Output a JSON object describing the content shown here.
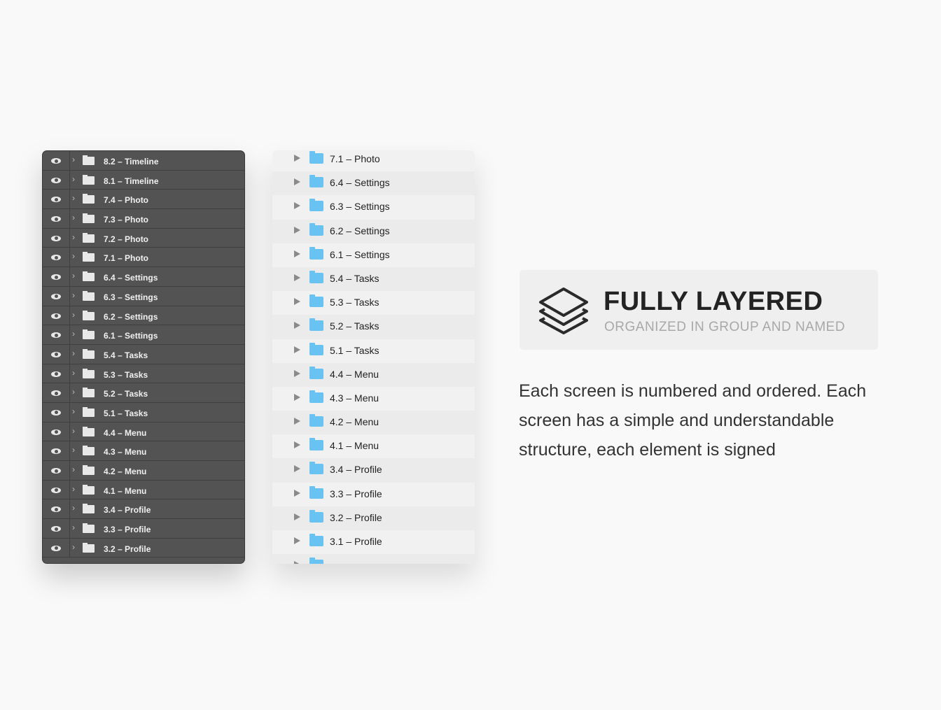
{
  "dark_panel": {
    "layers": [
      "8.2 – Timeline",
      "8.1 – Timeline",
      "7.4 – Photo",
      "7.3 – Photo",
      "7.2 – Photo",
      "7.1 – Photo",
      "6.4 – Settings",
      "6.3 – Settings",
      "6.2 – Settings",
      "6.1 – Settings",
      "5.4 – Tasks",
      "5.3 – Tasks",
      "5.2 – Tasks",
      "5.1 – Tasks",
      "4.4 – Menu",
      "4.3 – Menu",
      "4.2 – Menu",
      "4.1 – Menu",
      "3.4 – Profile",
      "3.3 – Profile",
      "3.2 – Profile"
    ]
  },
  "light_panel": {
    "folders": [
      "7.1 – Photo",
      "6.4 – Settings",
      "6.3 – Settings",
      "6.2 – Settings",
      "6.1 – Settings",
      "5.4 – Tasks",
      "5.3 – Tasks",
      "5.2 – Tasks",
      "5.1 – Tasks",
      "4.4 – Menu",
      "4.3 – Menu",
      "4.2 – Menu",
      "4.1 – Menu",
      "3.4 – Profile",
      "3.3 – Profile",
      "3.2 – Profile",
      "3.1 – Profile"
    ],
    "folder_color": "#68c3f3"
  },
  "feature": {
    "icon": "layers-icon",
    "title": "FULLY LAYERED",
    "subtitle": "ORGANIZED IN GROUP AND NAMED"
  },
  "description": "Each screen is numbered and ordered. Each screen has a simple and understandable structure, each element is signed"
}
